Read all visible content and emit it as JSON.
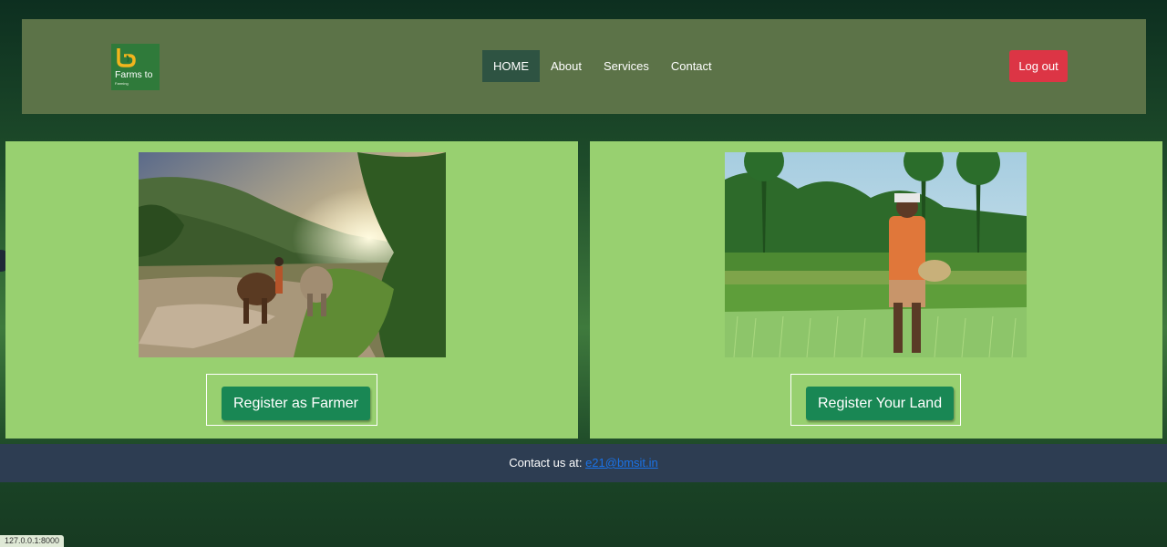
{
  "header": {
    "logo": {
      "line1": "Farms to",
      "line2": "Farming"
    },
    "nav": [
      {
        "label": "HOME",
        "active": true
      },
      {
        "label": "About",
        "active": false
      },
      {
        "label": "Services",
        "active": false
      },
      {
        "label": "Contact",
        "active": false
      }
    ],
    "logout_label": "Log out"
  },
  "cards": {
    "farmer": {
      "button_label": "Register as Farmer"
    },
    "land": {
      "button_label": "Register Your Land"
    }
  },
  "footer": {
    "prefix": "Contact us at:",
    "email": "e21@bmsit.in"
  },
  "status_bar": {
    "url": "127.0.0.1:8000"
  },
  "colors": {
    "header_bg": "#5c7348",
    "nav_active": "#2e5342",
    "logout": "#dc3545",
    "card_bg": "#98d070",
    "register_button": "#198754",
    "footer_bg": "#2d3d52",
    "link": "#1a73e8"
  }
}
